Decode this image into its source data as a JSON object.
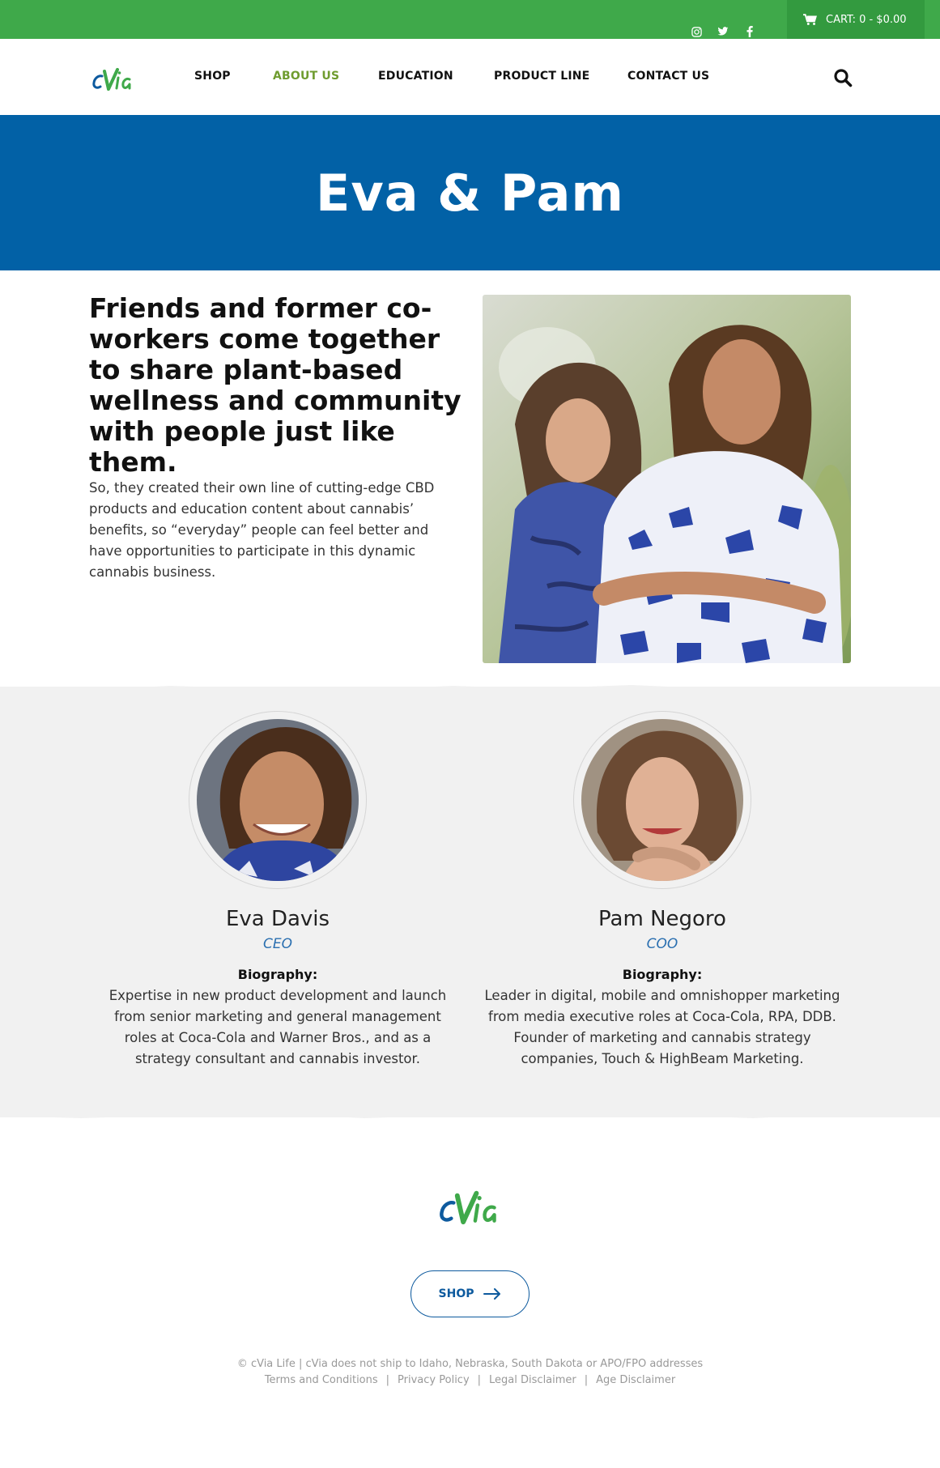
{
  "topbar": {
    "social": [
      "instagram-icon",
      "twitter-icon",
      "facebook-icon"
    ],
    "cart_label": "CART: 0 - $0.00"
  },
  "header": {
    "logo_text": "cVia",
    "nav": [
      {
        "label": "SHOP",
        "active": false
      },
      {
        "label": "ABOUT US",
        "active": true
      },
      {
        "label": "EDUCATION",
        "active": false
      },
      {
        "label": "PRODUCT LINE",
        "active": false
      },
      {
        "label": "CONTACT US",
        "active": false
      }
    ]
  },
  "hero": {
    "title": "Eva & Pam"
  },
  "intro": {
    "headline": "Friends and former co-workers come together to share plant-based wellness and community with people just like them.",
    "body": "So, they created their own line of cutting-edge CBD products and education content about cannabis’ benefits, so “everyday” people can feel better and have opportunities to participate in this dynamic cannabis business."
  },
  "team": [
    {
      "name": "Eva Davis",
      "role": "CEO",
      "bio_title": "Biography:",
      "bio": "Expertise in new product development and launch from senior marketing and general management roles at Coca-Cola and Warner Bros., and as a strategy consultant and cannabis investor."
    },
    {
      "name": "Pam Negoro",
      "role": "COO",
      "bio_title": "Biography:",
      "bio": "Leader in digital, mobile and omnishopper marketing from media executive roles at Coca-Cola, RPA, DDB. Founder of marketing and cannabis strategy companies, Touch & HighBeam Marketing."
    }
  ],
  "footer": {
    "logo_text": "cVia",
    "shop_label": "SHOP",
    "copyright": "© cVia Life | cVia does not ship to Idaho, Nebraska, South Dakota or APO/FPO addresses",
    "links": [
      "Terms and Conditions",
      "Privacy Policy",
      "Legal Disclaimer",
      "Age Disclaimer"
    ],
    "separator": "|"
  },
  "colors": {
    "topbar": "#3fa94a",
    "hero": "#0261a6",
    "active_nav": "#6f9c2f",
    "role": "#2a6fb0"
  }
}
